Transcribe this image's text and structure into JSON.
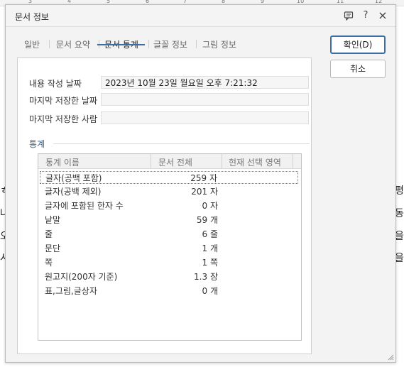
{
  "ruler": {
    "marks": [
      "3",
      "4",
      "5",
      "6",
      "7",
      "8",
      "9",
      "10",
      "11",
      "12"
    ]
  },
  "background_doc": {
    "left_glyphs": [
      "ㅎ",
      "나",
      "오",
      "시"
    ],
    "right_glyphs": [
      "평",
      "동",
      "을",
      "을"
    ]
  },
  "dialog": {
    "title": "문서 정보",
    "help_glyph": "?",
    "close_glyph": "×"
  },
  "tabs": [
    {
      "label": "일반"
    },
    {
      "label": "문서 요약"
    },
    {
      "label": "문서 통계"
    },
    {
      "label": "글꼴 정보"
    },
    {
      "label": "그림 정보"
    }
  ],
  "active_tab": "문서 통계",
  "fields": {
    "created_label": "내용 작성 날짜",
    "created_value": "2023년 10월 23일 월요일 오후 7:21:32",
    "last_saved_date_label": "마지막 저장한 날짜",
    "last_saved_date_value": "",
    "last_saved_by_label": "마지막 저장한 사람",
    "last_saved_by_value": ""
  },
  "stats": {
    "section_title": "통계",
    "columns": [
      "통계 이름",
      "문서 전체",
      "현재 선택 영역"
    ],
    "rows": [
      {
        "name": "글자(공백 포함)",
        "total": "259 자"
      },
      {
        "name": "글자(공백 제외)",
        "total": "201 자"
      },
      {
        "name": "글자에 포함된 한자 수",
        "total": "0 자"
      },
      {
        "name": "낱말",
        "total": "59 개"
      },
      {
        "name": "줄",
        "total": "6 줄"
      },
      {
        "name": "문단",
        "total": "1 개"
      },
      {
        "name": "쪽",
        "total": "1 쪽"
      },
      {
        "name": "원고지(200자 기준)",
        "total": "1.3 장"
      },
      {
        "name": "표,그림,글상자",
        "total": "0 개"
      }
    ]
  },
  "buttons": {
    "ok_label": "확인(D)",
    "cancel_label": "취소"
  },
  "colors": {
    "accent": "#3a6ea5",
    "section": "#2f5d92"
  }
}
